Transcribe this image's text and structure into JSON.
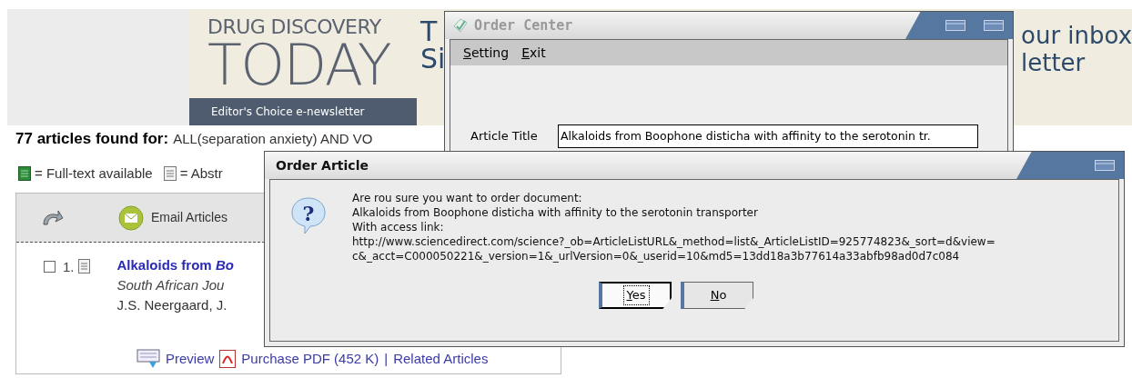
{
  "banner": {
    "logo_line_1": "DRUG DISCOVERY",
    "logo_line_2": "TODAY",
    "strip": "Editor's Choice e-newsletter",
    "headline_left": [
      "T",
      "Si"
    ],
    "headline_right": [
      "our inbox",
      "letter"
    ]
  },
  "results": {
    "count_label": "77 articles found for:",
    "query": "ALL(separation anxiety) AND VO"
  },
  "legend": [
    {
      "kind": "fulltext",
      "label": "= Full-text available"
    },
    {
      "kind": "abstract",
      "label": "= Abstr"
    }
  ],
  "toolbar": {
    "email": "Email Articles"
  },
  "articles": [
    {
      "checked": false,
      "number": "1.",
      "title": "Alkaloids from *Bo*",
      "journal": "South African Jou",
      "authors": "J.S. Neergaard, J.",
      "links": [
        "Preview",
        "Purchase PDF (452 K)",
        "|",
        "Related Articles"
      ]
    }
  ],
  "order_center": {
    "title": "Order Center",
    "menu": [
      "Setting",
      "Exit"
    ],
    "field_label": "Article Title",
    "field_value": "Alkaloids from Boophone disticha with affinity to the serotonin tr."
  },
  "dialog": {
    "title": "Order Article",
    "icon": "?",
    "message": [
      "Are rou sure you want to order document:",
      "Alkaloids from Boophone disticha with affinity to the serotonin transporter",
      "With access link:",
      "http://www.sciencedirect.com/science?_ob=ArticleListURL&_method=list&_ArticleListID=925774823&_sort=d&view=",
      "c&_acct=C000050221&_version=1&_urlVersion=0&_userid=10&md5=13dd18a3b77614a33abfb98ad0d7c084"
    ],
    "buttons": [
      {
        "label": "Yes",
        "selected": true
      },
      {
        "label": "No",
        "selected": false
      }
    ]
  }
}
